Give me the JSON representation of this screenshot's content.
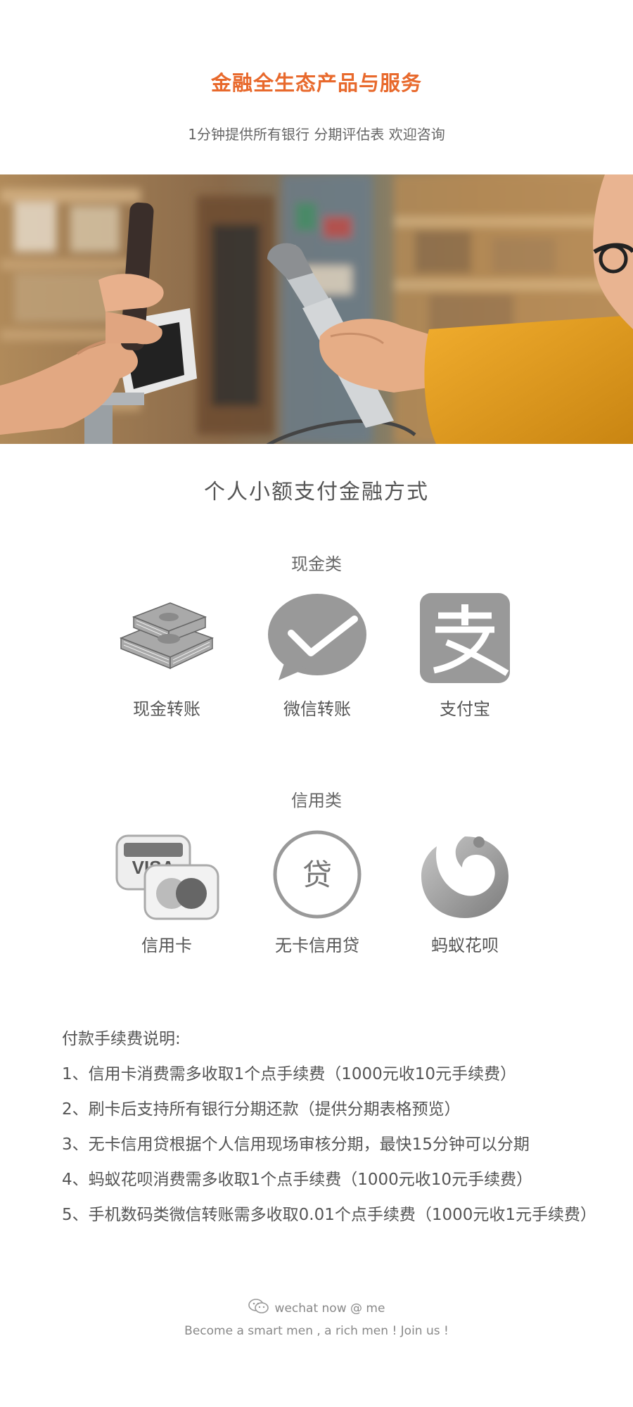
{
  "header": {
    "title": "金融全生态产品与服务",
    "subtitle": "1分钟提供所有银行 分期评估表 欢迎咨询"
  },
  "hero": {
    "image": "photo-phone-payment-scanner"
  },
  "section": {
    "title": "个人小额支付金融方式"
  },
  "cash_group": {
    "label": "现金类",
    "items": [
      {
        "label": "现金转账",
        "icon": "cash-stack-icon"
      },
      {
        "label": "微信转账",
        "icon": "wechat-pay-icon"
      },
      {
        "label": "支付宝",
        "icon": "alipay-icon"
      }
    ]
  },
  "credit_group": {
    "label": "信用类",
    "items": [
      {
        "label": "信用卡",
        "icon": "credit-card-icon"
      },
      {
        "label": "无卡信用贷",
        "icon": "loan-icon",
        "glyph": "贷",
        "brand": "VISA"
      },
      {
        "label": "蚂蚁花呗",
        "icon": "huabei-icon"
      }
    ]
  },
  "visa_text": "VISA",
  "notes": {
    "heading": "付款手续费说明:",
    "lines": [
      "1、信用卡消费需多收取1个点手续费（1000元收10元手续费）",
      "2、刷卡后支持所有银行分期还款（提供分期表格预览）",
      "3、无卡信用贷根据个人信用现场审核分期，最快15分钟可以分期",
      "4、蚂蚁花呗消费需多收取1个点手续费（1000元收10元手续费）",
      "5、手机数码类微信转账需多收取0.01个点手续费（1000元收1元手续费）"
    ]
  },
  "footer": {
    "line1": "wechat now @ me",
    "line2": "Become a smart men , a rich men ! Join us !"
  },
  "colors": {
    "accent": "#e8692c",
    "icon_gray": "#999999",
    "text": "#555555"
  }
}
